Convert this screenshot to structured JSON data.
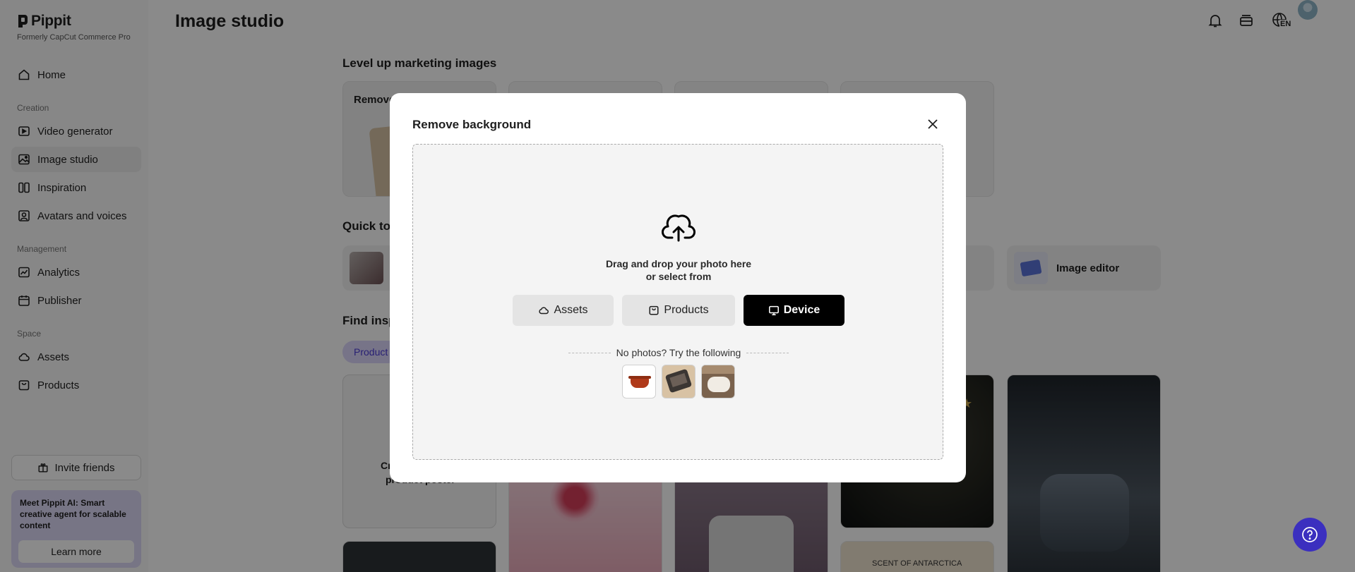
{
  "brand": {
    "name": "Pippit",
    "subtitle": "Formerly CapCut Commerce Pro"
  },
  "sidebar": {
    "items": [
      {
        "label": "Home",
        "icon": "home-icon"
      },
      {
        "label": "Video generator",
        "icon": "video-generator-icon"
      },
      {
        "label": "Image studio",
        "icon": "image-studio-icon",
        "active": true
      },
      {
        "label": "Inspiration",
        "icon": "inspiration-icon"
      },
      {
        "label": "Avatars and voices",
        "icon": "avatar-icon"
      },
      {
        "label": "Analytics",
        "icon": "analytics-icon"
      },
      {
        "label": "Publisher",
        "icon": "calendar-icon"
      },
      {
        "label": "Assets",
        "icon": "cloud-icon"
      },
      {
        "label": "Products",
        "icon": "bag-icon"
      }
    ],
    "sections": {
      "creation": "Creation",
      "management": "Management",
      "space": "Space"
    },
    "invite_label": "Invite friends",
    "promo_text": "Meet Pippit AI: Smart creative agent for scalable content",
    "promo_button": "Learn more"
  },
  "header": {
    "title": "Image studio",
    "icons": [
      "bell-icon",
      "inbox-icon",
      "globe-icon"
    ],
    "language": "EN"
  },
  "main": {
    "level_up_title": "Level up marketing images",
    "first_card_label": "Remove",
    "quick_tools_title": "Quick to",
    "image_editor_label": "Image editor",
    "find_inspiration_title": "Find insp",
    "chip_label": "Product",
    "poster_text_1": "Cr",
    "poster_text_2": "product poster",
    "antarctica_text": "SCENT OF ANTARCTICA"
  },
  "modal": {
    "title": "Remove background",
    "drop_line_1": "Drag and drop your photo here",
    "drop_line_2": "or select from",
    "buttons": [
      {
        "label": "Assets",
        "icon": "cloud-icon"
      },
      {
        "label": "Products",
        "icon": "bag-icon"
      },
      {
        "label": "Device",
        "icon": "monitor-icon"
      }
    ],
    "try_text": "No photos? Try the following",
    "samples": [
      "sample-pot",
      "sample-palette",
      "sample-stool"
    ]
  },
  "colors": {
    "accent": "#3b2fbf",
    "chip": "#dcd6fb",
    "promo": "#ddd8f6",
    "dark_button": "#000000"
  }
}
